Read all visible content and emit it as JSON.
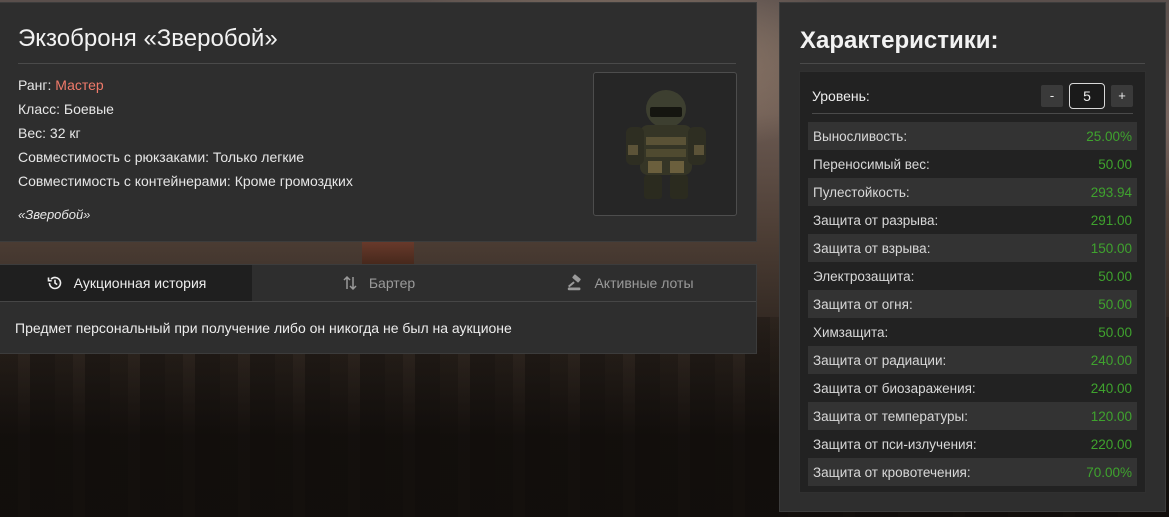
{
  "item": {
    "title": "Экзоброня «Зверобой»",
    "rank_label": "Ранг: ",
    "rank_value": "Мастер",
    "class_line": "Класс: Боевые",
    "weight_line": "Вес: 32 кг",
    "backpack_line": "Совместимость с рюкзаками: Только легкие",
    "container_line": "Совместимость с контейнерами: Кроме громоздких",
    "quote": "«Зверобой»",
    "image_icon": "exoskeleton-armor-image"
  },
  "tabs": [
    {
      "label": "Аукционная история",
      "icon": "history-icon",
      "active": true
    },
    {
      "label": "Бартер",
      "icon": "swap-arrows-icon",
      "active": false
    },
    {
      "label": "Активные лоты",
      "icon": "gavel-icon",
      "active": false
    }
  ],
  "tab_message": "Предмет персональный при получение либо он никогда не был на аукционе",
  "stats": {
    "title": "Характеристики:",
    "level_label": "Уровень:",
    "minus_label": "-",
    "plus_label": "+",
    "level_value": "5",
    "rows": [
      {
        "name": "Выносливость:",
        "value": "25.00%"
      },
      {
        "name": "Переносимый вес:",
        "value": "50.00"
      },
      {
        "name": "Пулестойкость:",
        "value": "293.94"
      },
      {
        "name": "Защита от разрыва:",
        "value": "291.00"
      },
      {
        "name": "Защита от взрыва:",
        "value": "150.00"
      },
      {
        "name": "Электрозащита:",
        "value": "50.00"
      },
      {
        "name": "Защита от огня:",
        "value": "50.00"
      },
      {
        "name": "Химзащита:",
        "value": "50.00"
      },
      {
        "name": "Защита от радиации:",
        "value": "240.00"
      },
      {
        "name": "Защита от биозаражения:",
        "value": "240.00"
      },
      {
        "name": "Защита от температуры:",
        "value": "120.00"
      },
      {
        "name": "Защита от пси-излучения:",
        "value": "220.00"
      },
      {
        "name": "Защита от кровотечения:",
        "value": "70.00%"
      }
    ]
  },
  "colors": {
    "rank": "#f07a6a",
    "stat_value": "#3fa32e",
    "panel_bg": "#2e2e2e"
  }
}
